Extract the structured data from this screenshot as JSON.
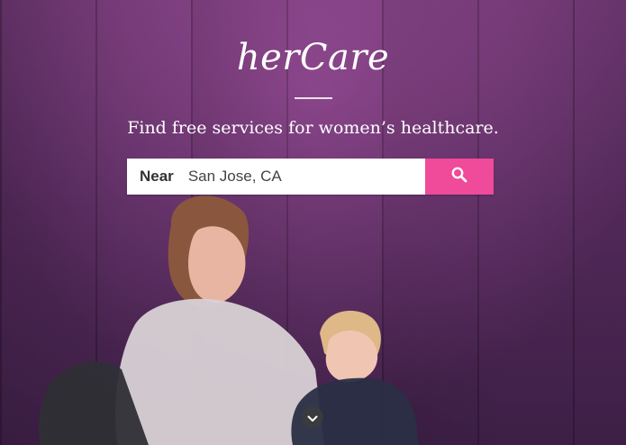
{
  "brand": {
    "logo_text": "herCare",
    "accent_color": "#f04a9a"
  },
  "hero": {
    "tagline": "Find free services for women’s healthcare."
  },
  "search": {
    "label": "Near",
    "value": "San Jose, CA",
    "button_icon": "search-icon"
  },
  "scroll": {
    "icon": "chevron-down-icon"
  }
}
